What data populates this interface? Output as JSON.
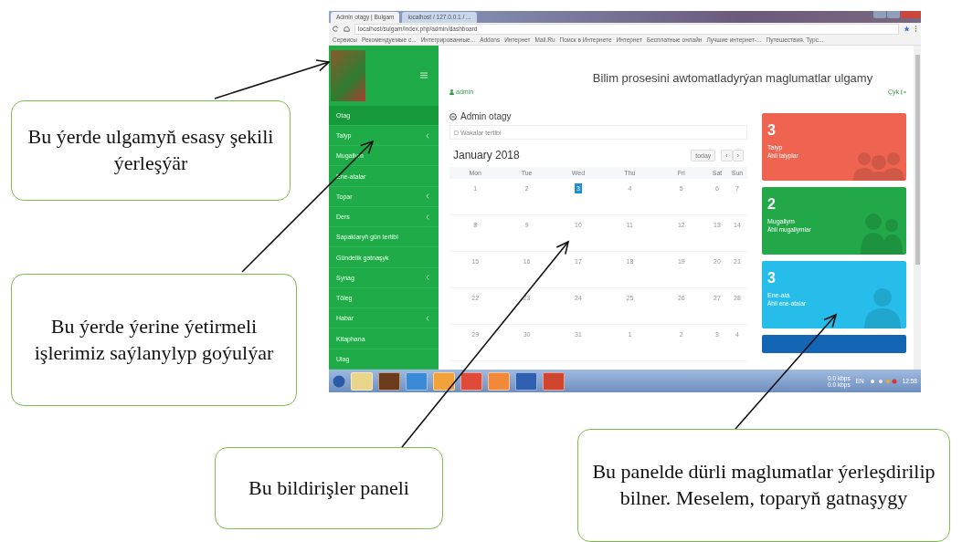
{
  "browser": {
    "tabs": [
      {
        "title": "Admin otagy | Bulgam",
        "selected": true
      },
      {
        "title": "localhost / 127.0.0.1 / ...",
        "selected": false
      }
    ],
    "address": "localhost/sulgam/index.php/admin/dashboard",
    "bookmarks": [
      "Сервисы",
      "Рекомендуемые с...",
      "Интегрированные...",
      "Addons",
      "Интернет",
      "Mail.Ru",
      "Поиск в Интернете",
      "Интернет",
      "Бесплатные онлайн",
      "Лучшие интернет-...",
      "Путешествия. Турс..."
    ]
  },
  "sidebar": {
    "items": [
      {
        "label": "Otag",
        "selected": true,
        "has_submenu": false
      },
      {
        "label": "Talyp",
        "selected": false,
        "has_submenu": true
      },
      {
        "label": "Mugallym",
        "selected": false,
        "has_submenu": false
      },
      {
        "label": "Ene-atalar",
        "selected": false,
        "has_submenu": false
      },
      {
        "label": "Topar",
        "selected": false,
        "has_submenu": true
      },
      {
        "label": "Ders",
        "selected": false,
        "has_submenu": true
      },
      {
        "label": "Sapaklaryň gün tertibi",
        "selected": false,
        "has_submenu": false
      },
      {
        "label": "Gündelik gatnaşyk",
        "selected": false,
        "has_submenu": false
      },
      {
        "label": "Synag",
        "selected": false,
        "has_submenu": true
      },
      {
        "label": "Töleg",
        "selected": false,
        "has_submenu": false
      },
      {
        "label": "Habar",
        "selected": false,
        "has_submenu": true
      },
      {
        "label": "Kitaphana",
        "selected": false,
        "has_submenu": false
      },
      {
        "label": "Ulag",
        "selected": false,
        "has_submenu": false
      }
    ]
  },
  "header": {
    "title": "Bilim prosesini awtomatladyrýan maglumatlar ulgamy",
    "user": "admin",
    "logout": "Çyk"
  },
  "section_title": "Admin otagy",
  "panel_title": "Wakalar tertibi",
  "calendar": {
    "month": "January 2018",
    "today_button": "today",
    "prev": "‹",
    "next": "›",
    "weekdays": [
      "Mon",
      "Tue",
      "Wed",
      "Thu",
      "Fri",
      "Sat",
      "Sun"
    ],
    "weeks": [
      [
        {
          "day": "1",
          "selected": false
        },
        {
          "day": "2",
          "selected": false
        },
        {
          "day": "3",
          "selected": true
        },
        {
          "day": "4",
          "selected": false
        },
        {
          "day": "5",
          "selected": false
        },
        {
          "day": "6",
          "selected": false
        },
        {
          "day": "7",
          "selected": false
        }
      ],
      [
        {
          "day": "8",
          "selected": false
        },
        {
          "day": "9",
          "selected": false
        },
        {
          "day": "10",
          "selected": false
        },
        {
          "day": "11",
          "selected": false
        },
        {
          "day": "12",
          "selected": false
        },
        {
          "day": "13",
          "selected": false
        },
        {
          "day": "14",
          "selected": false
        }
      ],
      [
        {
          "day": "15",
          "selected": false
        },
        {
          "day": "16",
          "selected": false
        },
        {
          "day": "17",
          "selected": false
        },
        {
          "day": "18",
          "selected": false
        },
        {
          "day": "19",
          "selected": false
        },
        {
          "day": "20",
          "selected": false
        },
        {
          "day": "21",
          "selected": false
        }
      ],
      [
        {
          "day": "22",
          "selected": false
        },
        {
          "day": "23",
          "selected": false
        },
        {
          "day": "24",
          "selected": false
        },
        {
          "day": "25",
          "selected": false
        },
        {
          "day": "26",
          "selected": false
        },
        {
          "day": "27",
          "selected": false
        },
        {
          "day": "28",
          "selected": false
        }
      ],
      [
        {
          "day": "29",
          "selected": false
        },
        {
          "day": "30",
          "selected": false
        },
        {
          "day": "31",
          "selected": false
        },
        {
          "day": "1",
          "selected": false
        },
        {
          "day": "2",
          "selected": false
        },
        {
          "day": "3",
          "selected": false
        },
        {
          "day": "4",
          "selected": false
        }
      ]
    ]
  },
  "cards": [
    {
      "value": "3",
      "label": "Talyp",
      "link": "Ähli talyplar",
      "color": "#ee6450",
      "kind": "group"
    },
    {
      "value": "2",
      "label": "Mugallym",
      "link": "Ähli mugallymlar",
      "color": "#22a848",
      "kind": "pair"
    },
    {
      "value": "3",
      "label": "Ene-ata",
      "link": "Ähli ene-atalar",
      "color": "#26bdea",
      "kind": "single"
    },
    {
      "color": "#1565b5",
      "kind": "cut"
    }
  ],
  "taskbar": {
    "network": [
      "0.0 kbps",
      "0.0 kbps"
    ],
    "language": "EN",
    "time": "12:58"
  },
  "callouts": [
    {
      "text": "Bu ýerde ulgamyň esasy şekili ýerleşýär"
    },
    {
      "text": "Bu ýerde ýerine ýetirmeli işlerimiz saýlanylyp goýulýar"
    },
    {
      "text": "Bu bildirişler paneli"
    },
    {
      "text": "Bu panelde dürli maglumatlar ýerleşdirilip bilner. Meselem, toparyň gatnaşygy"
    }
  ]
}
